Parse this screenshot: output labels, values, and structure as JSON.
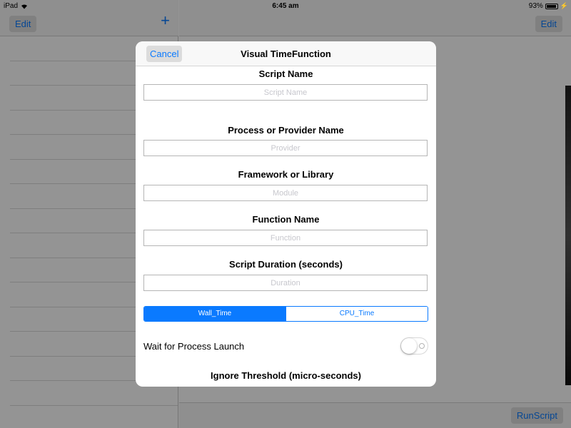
{
  "status": {
    "device": "iPad",
    "time": "6:45 am",
    "battery": "93%"
  },
  "master": {
    "edit_label": "Edit",
    "add_label": "+"
  },
  "detail": {
    "edit_label": "Edit",
    "run_label": "RunScript"
  },
  "modal": {
    "title": "Visual TimeFunction",
    "cancel_label": "Cancel",
    "fields": [
      {
        "label": "Script Name",
        "placeholder": "Script Name"
      },
      {
        "label": "Process or Provider Name",
        "placeholder": "Provider"
      },
      {
        "label": "Framework or Library",
        "placeholder": "Module"
      },
      {
        "label": "Function Name",
        "placeholder": "Function"
      },
      {
        "label": "Script Duration (seconds)",
        "placeholder": "Duration"
      }
    ],
    "segments": [
      "Wall_Time",
      "CPU_Time"
    ],
    "selected_segment": "Wall_Time",
    "toggle": {
      "label": "Wait for Process Launch",
      "on": false
    },
    "threshold_label": "Ignore Threshold (micro-seconds)"
  },
  "colors": {
    "accent": "#0a7aff"
  }
}
